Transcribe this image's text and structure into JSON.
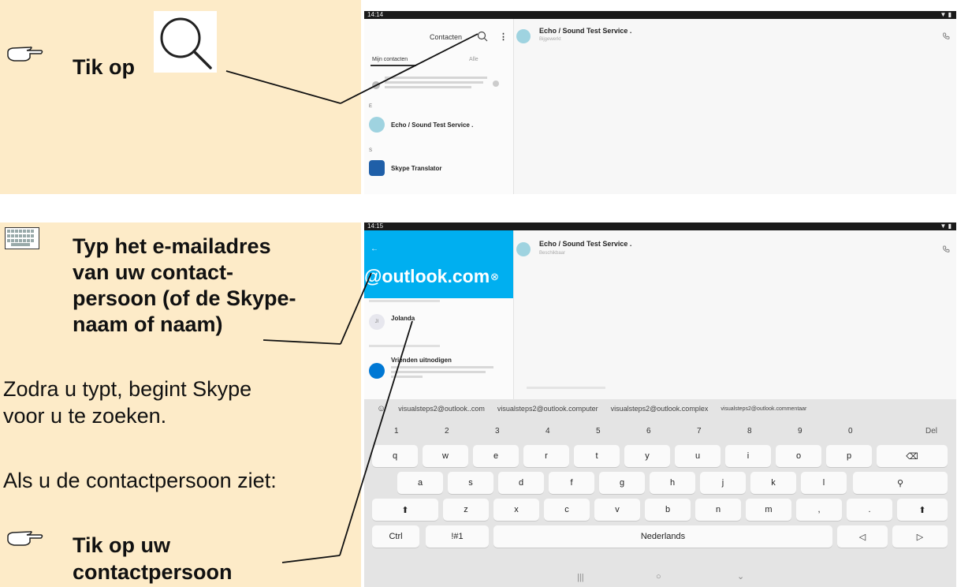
{
  "step1": {
    "instruction": "Tik op",
    "screen": {
      "status_time": "14:14",
      "header_title": "Contacten",
      "chat_title": "Echo / Sound Test Service .",
      "chat_subtitle": "Bijgewerkt",
      "tab_mine": "Mijn contacten",
      "tab_all": "Alle",
      "section_e": "E",
      "section_s": "S",
      "contact1": "Echo / Sound Test Service .",
      "contact2": "Skype Translator"
    }
  },
  "step2": {
    "instruction": "Typ het e-mailadres van uw contactpersoon (of de Skype-naam of naam)",
    "line1": "Typ het e-mailadres",
    "line2": "van uw contact-",
    "line3": "persoon (of de Skype-",
    "line4": "naam of naam)",
    "info1": "Zodra u typt, begint Skype",
    "info2": "voor u te zoeken.",
    "info3": "Als u de contactpersoon ziet:",
    "action1": "Tik op uw",
    "action2": "contactpersoon",
    "screen": {
      "status_time": "14:15",
      "search_text": "@outlook.com",
      "chat_title": "Echo / Sound Test Service .",
      "chat_subtitle": "Beschikbaar",
      "result_name": "Jolanda",
      "result_initials": "JI",
      "invite_title": "Vrienden uitnodigen",
      "suggestions": [
        "visualsteps2@outlook..com",
        "visualsteps2@outlook.computer",
        "visualsteps2@outlook.complex",
        "visualsteps2@outlook.commentaar"
      ],
      "keys_num": [
        "1",
        "2",
        "3",
        "4",
        "5",
        "6",
        "7",
        "8",
        "9",
        "0"
      ],
      "key_del": "Del",
      "keys_row1": [
        "q",
        "w",
        "e",
        "r",
        "t",
        "y",
        "u",
        "i",
        "o",
        "p"
      ],
      "keys_row2": [
        "a",
        "s",
        "d",
        "f",
        "g",
        "h",
        "j",
        "k",
        "l"
      ],
      "keys_row3": [
        "z",
        "x",
        "c",
        "v",
        "b",
        "n",
        "m",
        ",",
        "."
      ],
      "key_ctrl": "Ctrl",
      "key_sym": "!#1",
      "key_space": "Nederlands"
    }
  },
  "colors": {
    "panel_bg": "#fdebc8",
    "skype_blue": "#00aff0",
    "link_blue": "#0078d4"
  }
}
